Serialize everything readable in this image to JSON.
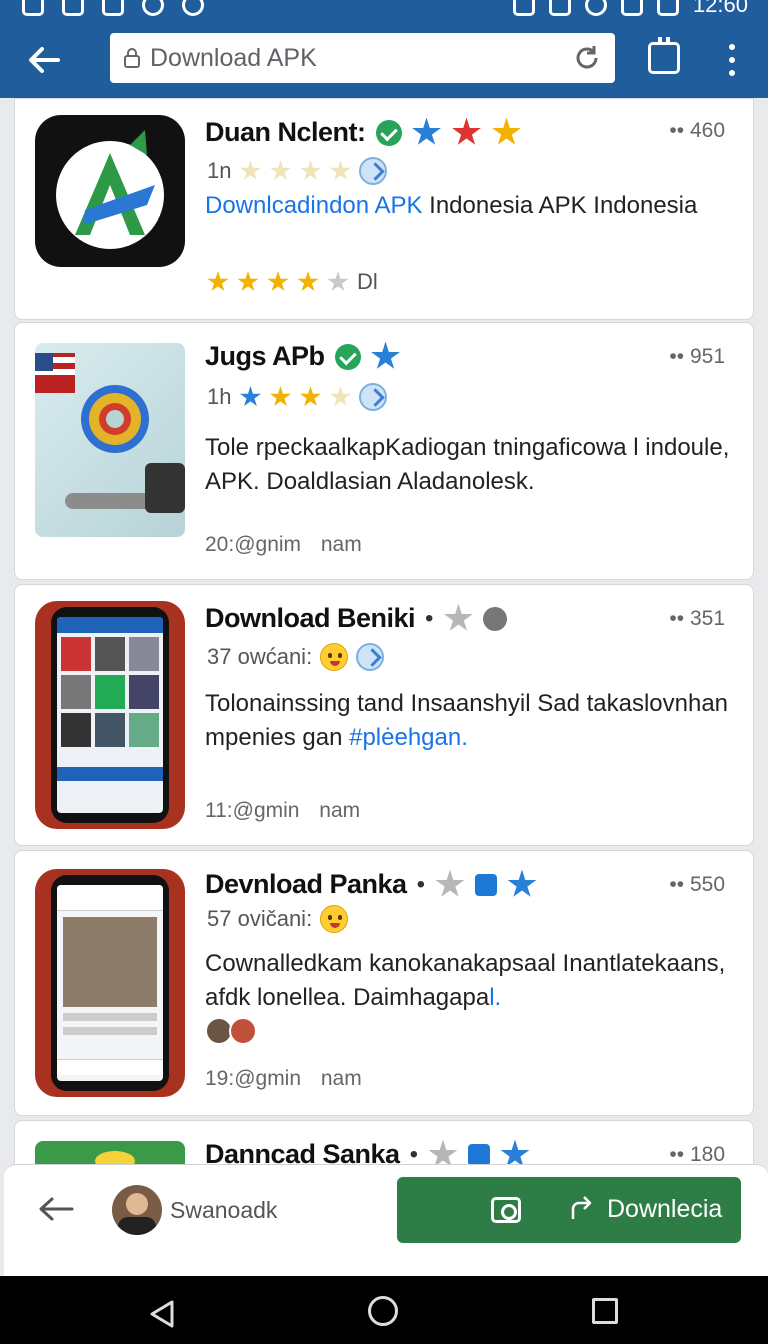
{
  "status": {
    "time": "12:60"
  },
  "browser": {
    "url": "Download  APK"
  },
  "cards": [
    {
      "title": "Duan Nclent:",
      "count": "•• 460",
      "meta": "1n",
      "desc_link": "Downlcadindon APK",
      "desc_text": " Indonesia APK Indonesia",
      "rating_suffix": "Dl"
    },
    {
      "title": "Jugs APb",
      "count": "•• 951",
      "meta": "1h",
      "desc_text": "Tole rpeckaalkapKadiogan tningaficowa l indoule, APK. Doaldlasian Aladanolesk.",
      "time": "20:@gnim nam"
    },
    {
      "title": "Download Beniki",
      "count": "•• 351",
      "meta": "37 owćani:",
      "desc_text": "Tolonainssing tand Insaanshyil Sad takaslovnhan mpenies gan ",
      "desc_link": "#plėehgan.",
      "time": "11:@gmin nam"
    },
    {
      "title": "Devnload Panka",
      "count": "•• 550",
      "meta": "57 ovičani:",
      "desc_text": "Cownalledkam kanokanakapsaal Inantlatekaans, afdk lonellea. Daimhagapa",
      "desc_link": "l.",
      "time": "19:@gmin nam"
    },
    {
      "title": "Danncad Sanka",
      "count": "•• 180"
    }
  ],
  "bottom": {
    "name": "Swanoadk",
    "download_label": "Downlecia"
  },
  "colors": {
    "appbar": "#1f5d9c",
    "download_button": "#2f7d46",
    "link": "#1a73e8"
  }
}
